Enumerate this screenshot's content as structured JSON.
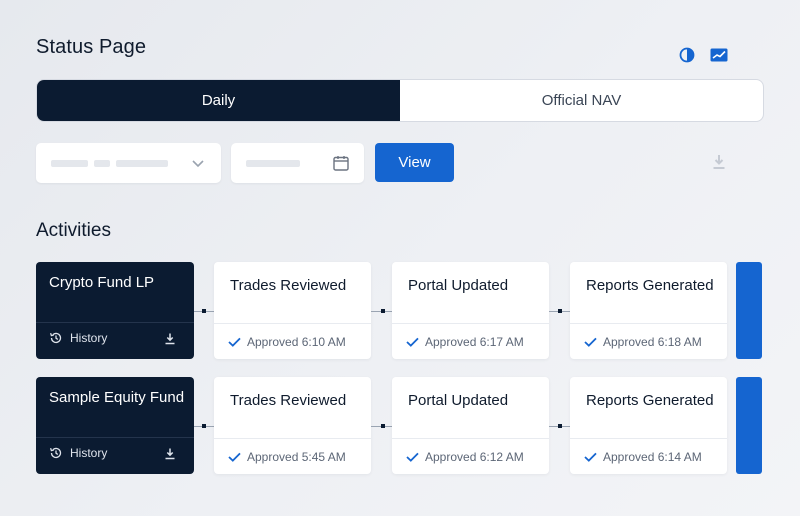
{
  "header": {
    "title": "Status Page"
  },
  "icons": {
    "contrast": "contrast-icon",
    "chart": "chart-icon",
    "download": "download-icon",
    "calendar": "calendar-icon",
    "chevron": "chevron-down-icon",
    "history": "history-icon",
    "check": "check-icon"
  },
  "tabs": [
    {
      "label": "Daily",
      "active": true
    },
    {
      "label": "Official NAV",
      "active": false
    }
  ],
  "filters": {
    "view_label": "View"
  },
  "activities": {
    "title": "Activities",
    "rows": [
      {
        "fund": "Crypto Fund LP",
        "history_label": "History",
        "steps": [
          {
            "title": "Trades Reviewed",
            "status": "Approved 6:10 AM"
          },
          {
            "title": "Portal Updated",
            "status": "Approved 6:17 AM"
          },
          {
            "title": "Reports Generated",
            "status": "Approved 6:18 AM"
          }
        ]
      },
      {
        "fund": "Sample Equity Fund",
        "history_label": "History",
        "steps": [
          {
            "title": "Trades Reviewed",
            "status": "Approved 5:45 AM"
          },
          {
            "title": "Portal Updated",
            "status": "Approved 6:12 AM"
          },
          {
            "title": "Reports Generated",
            "status": "Approved 6:14 AM"
          }
        ]
      }
    ]
  },
  "colors": {
    "navy": "#0b1b31",
    "accent_blue": "#1565d0",
    "background": "#eceef2",
    "check_blue": "#1565d0"
  }
}
